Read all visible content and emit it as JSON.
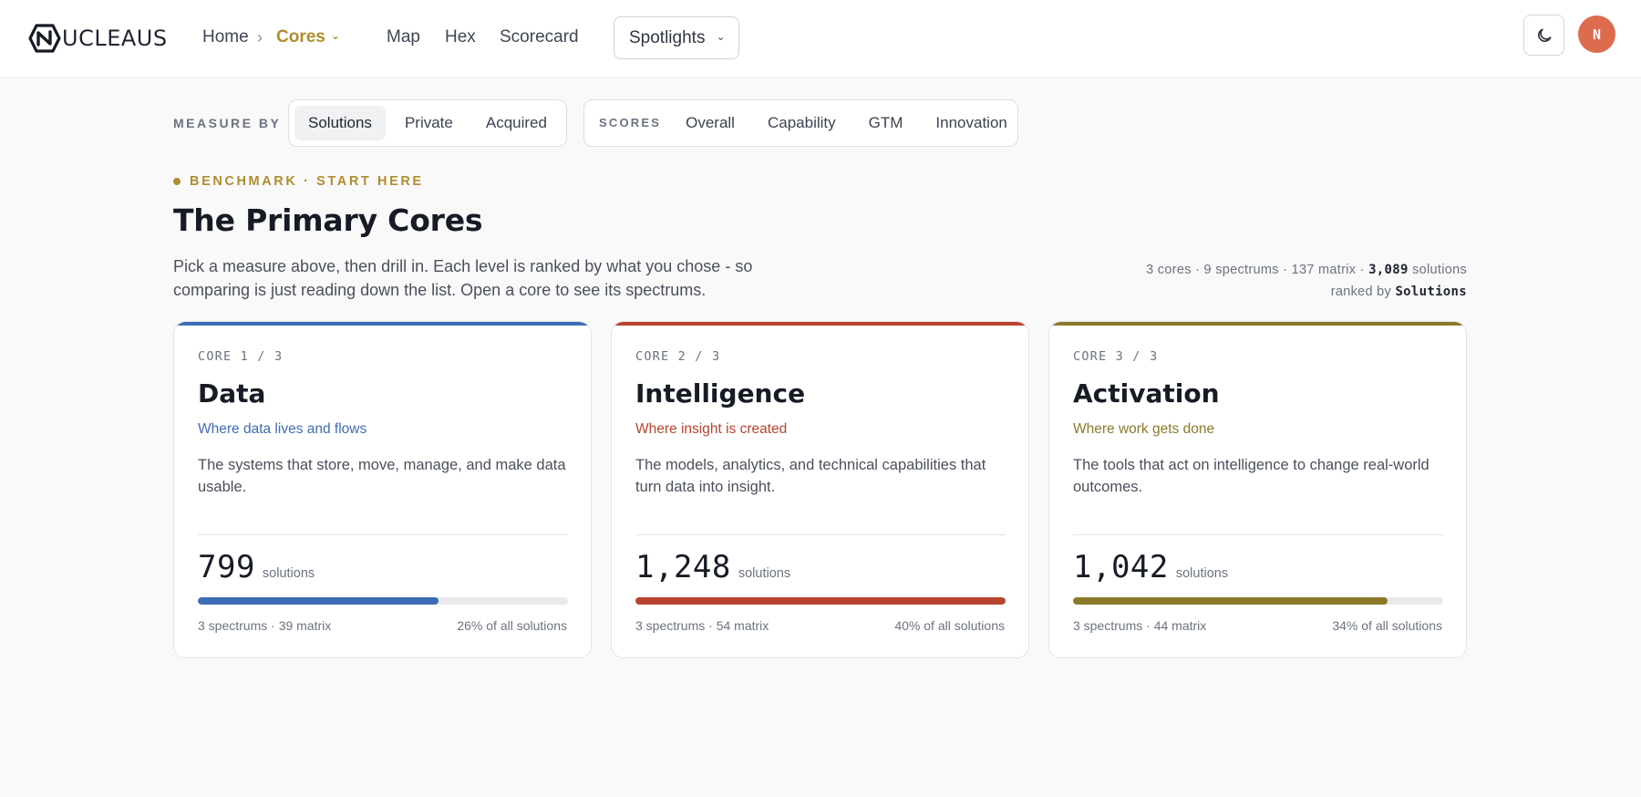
{
  "nav": {
    "logo_text": "UCLEAUS",
    "home": "Home",
    "separator": "›",
    "cores": "Cores",
    "map": "Map",
    "hex": "Hex",
    "scorecard": "Scorecard",
    "spotlights": "Spotlights",
    "avatar_initial": "N"
  },
  "measure": {
    "label": "MEASURE BY",
    "options": [
      "Solutions",
      "Private",
      "Acquired"
    ],
    "selected": "Solutions"
  },
  "scores": {
    "label": "SCORES",
    "options": [
      "Overall",
      "Capability",
      "GTM",
      "Innovation"
    ]
  },
  "header": {
    "eyebrow": "BENCHMARK · START HERE",
    "title": "The Primary Cores",
    "intro": "Pick a measure above, then drill in. Each level is ranked by what you chose - so comparing is just reading down the list. Open a core to see its spectrums.",
    "stats_prefix": "3 cores · 9 spectrums · 137 matrix · ",
    "stats_total": "3,089",
    "stats_suffix": " solutions",
    "ranked_by_label": "ranked by ",
    "ranked_by_value": "Solutions"
  },
  "cores": [
    {
      "kicker": "CORE 1 / 3",
      "title": "Data",
      "tagline": "Where data lives and flows",
      "description": "The systems that store, move, manage, and make data usable.",
      "count": "799",
      "unit": "solutions",
      "share": 0.26,
      "meta_left": "3 spectrums · 39 matrix",
      "meta_right": "26% of all solutions",
      "color": "#3f6db5"
    },
    {
      "kicker": "CORE 2 / 3",
      "title": "Intelligence",
      "tagline": "Where insight is created",
      "description": "The models, analytics, and technical capabilities that turn data into insight.",
      "count": "1,248",
      "unit": "solutions",
      "share": 0.4,
      "meta_left": "3 spectrums · 54 matrix",
      "meta_right": "40% of all solutions",
      "color": "#b8432f"
    },
    {
      "kicker": "CORE 3 / 3",
      "title": "Activation",
      "tagline": "Where work gets done",
      "description": "The tools that act on intelligence to change real-world outcomes.",
      "count": "1,042",
      "unit": "solutions",
      "share": 0.34,
      "meta_left": "3 spectrums · 44 matrix",
      "meta_right": "34% of all solutions",
      "color": "#8a7a2a"
    }
  ],
  "colors": {
    "accent": "#b08d2f",
    "avatar": "#dd6b4d"
  },
  "icons": {
    "theme": "moon-icon",
    "dropdown": "chevron-down-icon",
    "logo": "nucleaus-logo-mark"
  }
}
